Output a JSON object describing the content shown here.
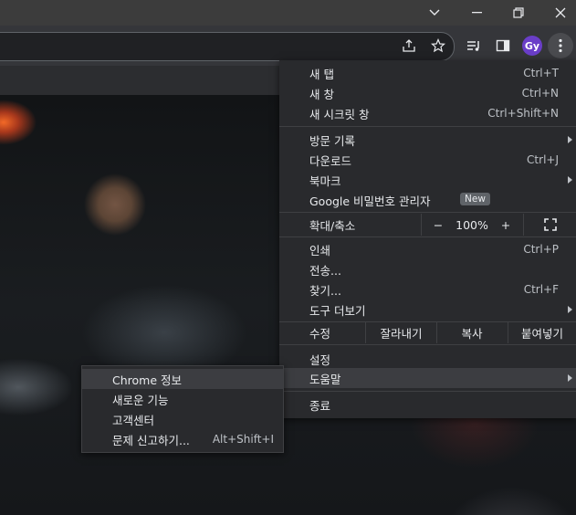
{
  "window": {
    "minimize_icon": "chevron-down-icon",
    "controls": [
      "minimize",
      "restore",
      "close"
    ]
  },
  "toolbar": {
    "icons": [
      "share-icon",
      "star-icon",
      "reading-list-icon",
      "side-panel-icon"
    ],
    "avatar_initials": "Gy"
  },
  "menu": {
    "items": [
      {
        "label": "새 탭",
        "shortcut": "Ctrl+T"
      },
      {
        "label": "새 창",
        "shortcut": "Ctrl+N"
      },
      {
        "label": "새 시크릿 창",
        "shortcut": "Ctrl+Shift+N"
      },
      {
        "label": "방문 기록",
        "shortcut": ""
      },
      {
        "label": "다운로드",
        "shortcut": "Ctrl+J"
      },
      {
        "label": "북마크",
        "shortcut": ""
      },
      {
        "label": "Google 비밀번호 관리자",
        "shortcut": "",
        "badge": "New"
      },
      {
        "label": "인쇄",
        "shortcut": "Ctrl+P"
      },
      {
        "label": "전송...",
        "shortcut": ""
      },
      {
        "label": "찾기...",
        "shortcut": "Ctrl+F"
      },
      {
        "label": "도구 더보기",
        "shortcut": ""
      },
      {
        "label": "설정",
        "shortcut": ""
      },
      {
        "label": "도움말",
        "shortcut": ""
      },
      {
        "label": "종료",
        "shortcut": ""
      }
    ],
    "zoom": {
      "label": "확대/축소",
      "minus": "−",
      "value": "100%",
      "plus": "+"
    },
    "edit": {
      "label": "수정",
      "cut": "잘라내기",
      "copy": "복사",
      "paste": "붙여넣기"
    }
  },
  "help_submenu": {
    "items": [
      {
        "label": "Chrome 정보",
        "shortcut": ""
      },
      {
        "label": "새로운 기능",
        "shortcut": ""
      },
      {
        "label": "고객센터",
        "shortcut": ""
      },
      {
        "label": "문제 신고하기...",
        "shortcut": "Alt+Shift+I"
      }
    ]
  },
  "colors": {
    "menu_bg": "#292a2d",
    "highlight": "#3c3d41",
    "avatar": "#6a3ec8"
  }
}
